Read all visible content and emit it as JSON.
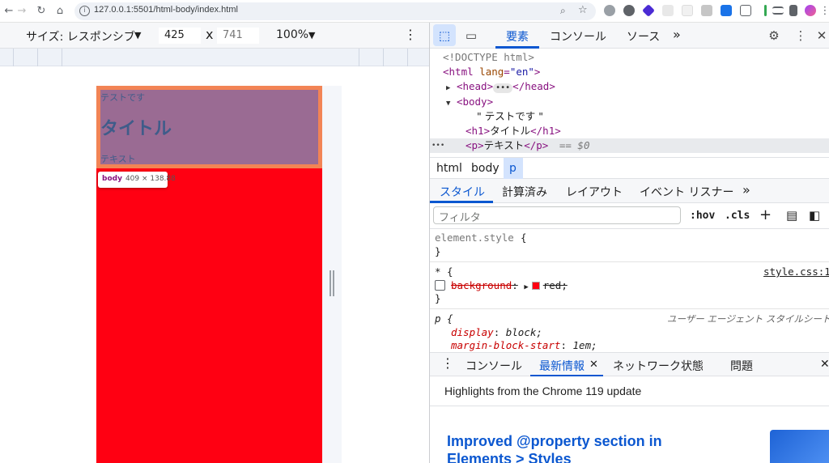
{
  "browser": {
    "url": "127.0.0.1:5501/html-body/index.html",
    "nav_icons": [
      "back-icon",
      "forward-icon",
      "reload-icon",
      "home-icon",
      "site-info-icon",
      "zoom-icon",
      "bookmark-star-icon"
    ]
  },
  "device_toolbar": {
    "size_label": "サイズ: レスポンシブ",
    "width": "425",
    "times": "x",
    "height": "741",
    "zoom": "100%"
  },
  "viewport": {
    "page_text": "テストです",
    "h1": "タイトル",
    "p": "テキスト",
    "tooltip_tag": "body",
    "tooltip_dims": "409 × 138.88",
    "body_color": "#ff0012"
  },
  "devtools": {
    "tabs": [
      "要素",
      "コンソール",
      "ソース"
    ],
    "more_tabs": "»",
    "dom": {
      "doctype": "<!DOCTYPE html>",
      "html_tag_open": "<html",
      "html_attr_name": " lang",
      "html_attr_eq": "=",
      "html_attr_value": "\"en\"",
      "html_tag_close": ">",
      "head_open": "<head>",
      "head_close": "</head>",
      "body_open": "<body>",
      "text_node": "\" テストです \"",
      "h1_open": "<h1>",
      "h1_text": "タイトル",
      "h1_close": "</h1>",
      "p_open": "<p>",
      "p_text": "テキスト",
      "p_close": "</p>",
      "selected_marker": "== $0",
      "ellipsis": "•••"
    },
    "breadcrumbs": [
      "html",
      "body",
      "p"
    ],
    "style_tabs": [
      "スタイル",
      "計算済み",
      "レイアウト",
      "イベント リスナー"
    ],
    "filter_placeholder": "フィルタ",
    "hov": ":hov",
    "cls": ".cls",
    "plus": "+",
    "rules": {
      "element_style_selector": "element.style",
      "open_brace": "{",
      "close_brace": "}",
      "star_selector": "* {",
      "star_source": "style.css:1",
      "background_prop": "background",
      "colon": ":",
      "background_value": "red;",
      "p_selector": "p {",
      "p_source": "ユーザー エージェント スタイルシート",
      "display_prop": "display",
      "display_value": "block;",
      "margin_prop": "margin-block-start",
      "margin_value": "1em;"
    },
    "drawer_tabs": [
      "コンソール",
      "最新情報",
      "ネットワーク状態",
      "問題"
    ],
    "highlights": "Highlights from the Chrome 119 update",
    "whatsnew_title": "Improved @property section in Elements > Styles"
  }
}
